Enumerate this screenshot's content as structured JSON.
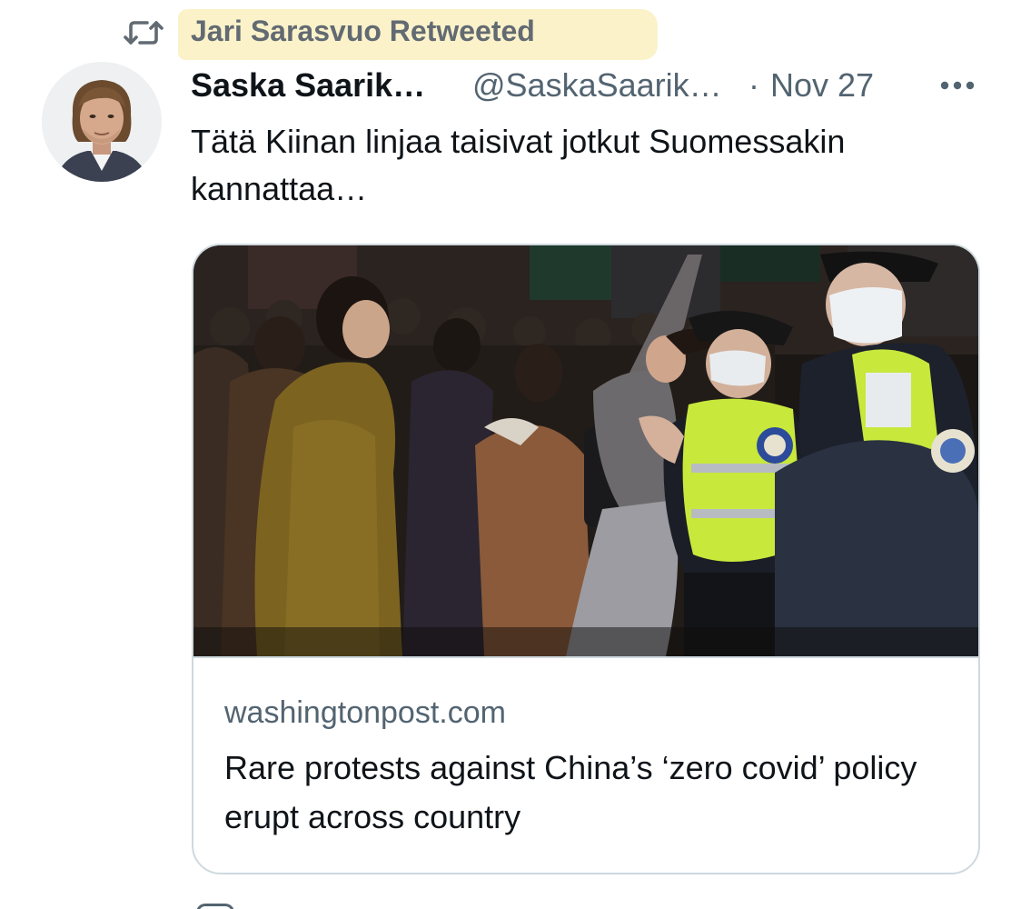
{
  "retweet": {
    "text": "Jari Sarasvuo Retweeted",
    "icon": "retweet-icon",
    "highlight_color": "#fbf1c7"
  },
  "tweet": {
    "author_name": "Saska Saarik…",
    "author_handle": "@SaskaSaarik…",
    "separator": "·",
    "date": "Nov 27",
    "text": "Tätä Kiinan linjaa taisivat jotkut Suomessakin kannattaa…",
    "more_icon": "more-horizontal-icon"
  },
  "card": {
    "domain": "washingtonpost.com",
    "title": "Rare protests against China’s ‘zero covid’ policy erupt across country",
    "image_subject": "protesters facing police officers in hi-vis vests at night"
  },
  "colors": {
    "primary_text": "#0f1419",
    "secondary_text": "#536471",
    "border": "#cfd9de",
    "police_vest": "#c8e83c"
  }
}
